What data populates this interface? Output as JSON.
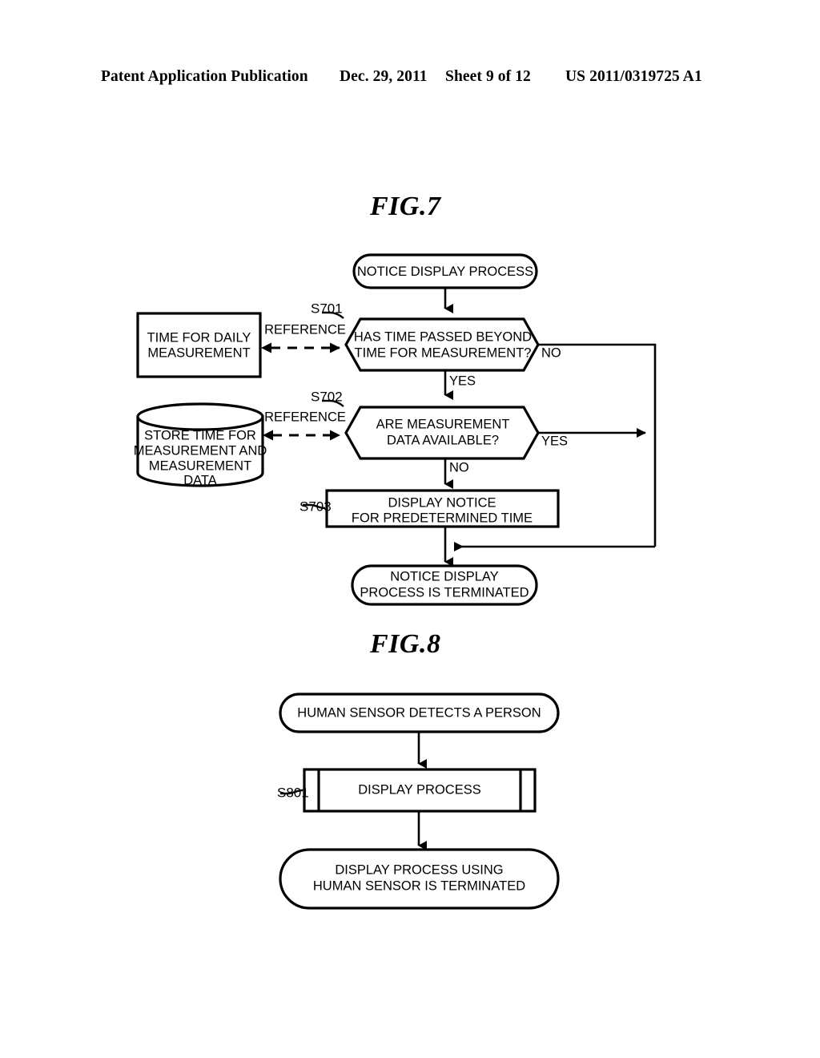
{
  "page": {
    "header": {
      "publication": "Patent Application Publication",
      "date": "Dec. 29, 2011",
      "sheet": "Sheet 9 of 12",
      "patent_number": "US 2011/0319725 A1"
    }
  },
  "figures": [
    {
      "caption": "FIG.7",
      "nodes": {
        "start": {
          "type": "terminator",
          "text_lines": [
            "NOTICE DISPLAY PROCESS"
          ]
        },
        "data_time": {
          "type": "data-store-rect",
          "text_lines": [
            "TIME FOR DAILY",
            "MEASUREMENT"
          ]
        },
        "data_store": {
          "type": "database-cylinder",
          "text_lines": [
            "STORE TIME FOR",
            "MEASUREMENT AND",
            "MEASUREMENT",
            "DATA"
          ]
        },
        "s701": {
          "type": "decision-hexagon",
          "step": "S701",
          "text_lines": [
            "HAS TIME PASSED BEYOND",
            "TIME FOR MEASUREMENT?"
          ]
        },
        "s702": {
          "type": "decision-hexagon",
          "step": "S702",
          "text_lines": [
            "ARE MEASUREMENT",
            "DATA AVAILABLE?"
          ]
        },
        "s703": {
          "type": "process-rect",
          "step": "S703",
          "text_lines": [
            "DISPLAY NOTICE",
            "FOR PREDETERMINED TIME"
          ]
        },
        "end": {
          "type": "terminator",
          "text_lines": [
            "NOTICE DISPLAY",
            "PROCESS IS TERMINATED"
          ]
        }
      },
      "edge_labels": {
        "reference_1": "REFERENCE",
        "reference_2": "REFERENCE",
        "s701_no": "NO",
        "s701_yes": "YES",
        "s702_yes": "YES",
        "s702_no": "NO"
      }
    },
    {
      "caption": "FIG.8",
      "nodes": {
        "start": {
          "type": "terminator",
          "text_lines": [
            "HUMAN SENSOR DETECTS A PERSON"
          ]
        },
        "s801": {
          "type": "predefined-process",
          "step": "S801",
          "text_lines": [
            "DISPLAY PROCESS"
          ]
        },
        "end": {
          "type": "terminator",
          "text_lines": [
            "DISPLAY PROCESS USING",
            "HUMAN SENSOR IS TERMINATED"
          ]
        }
      }
    }
  ],
  "colors": {
    "ink": "#000000",
    "paper": "#ffffff"
  }
}
